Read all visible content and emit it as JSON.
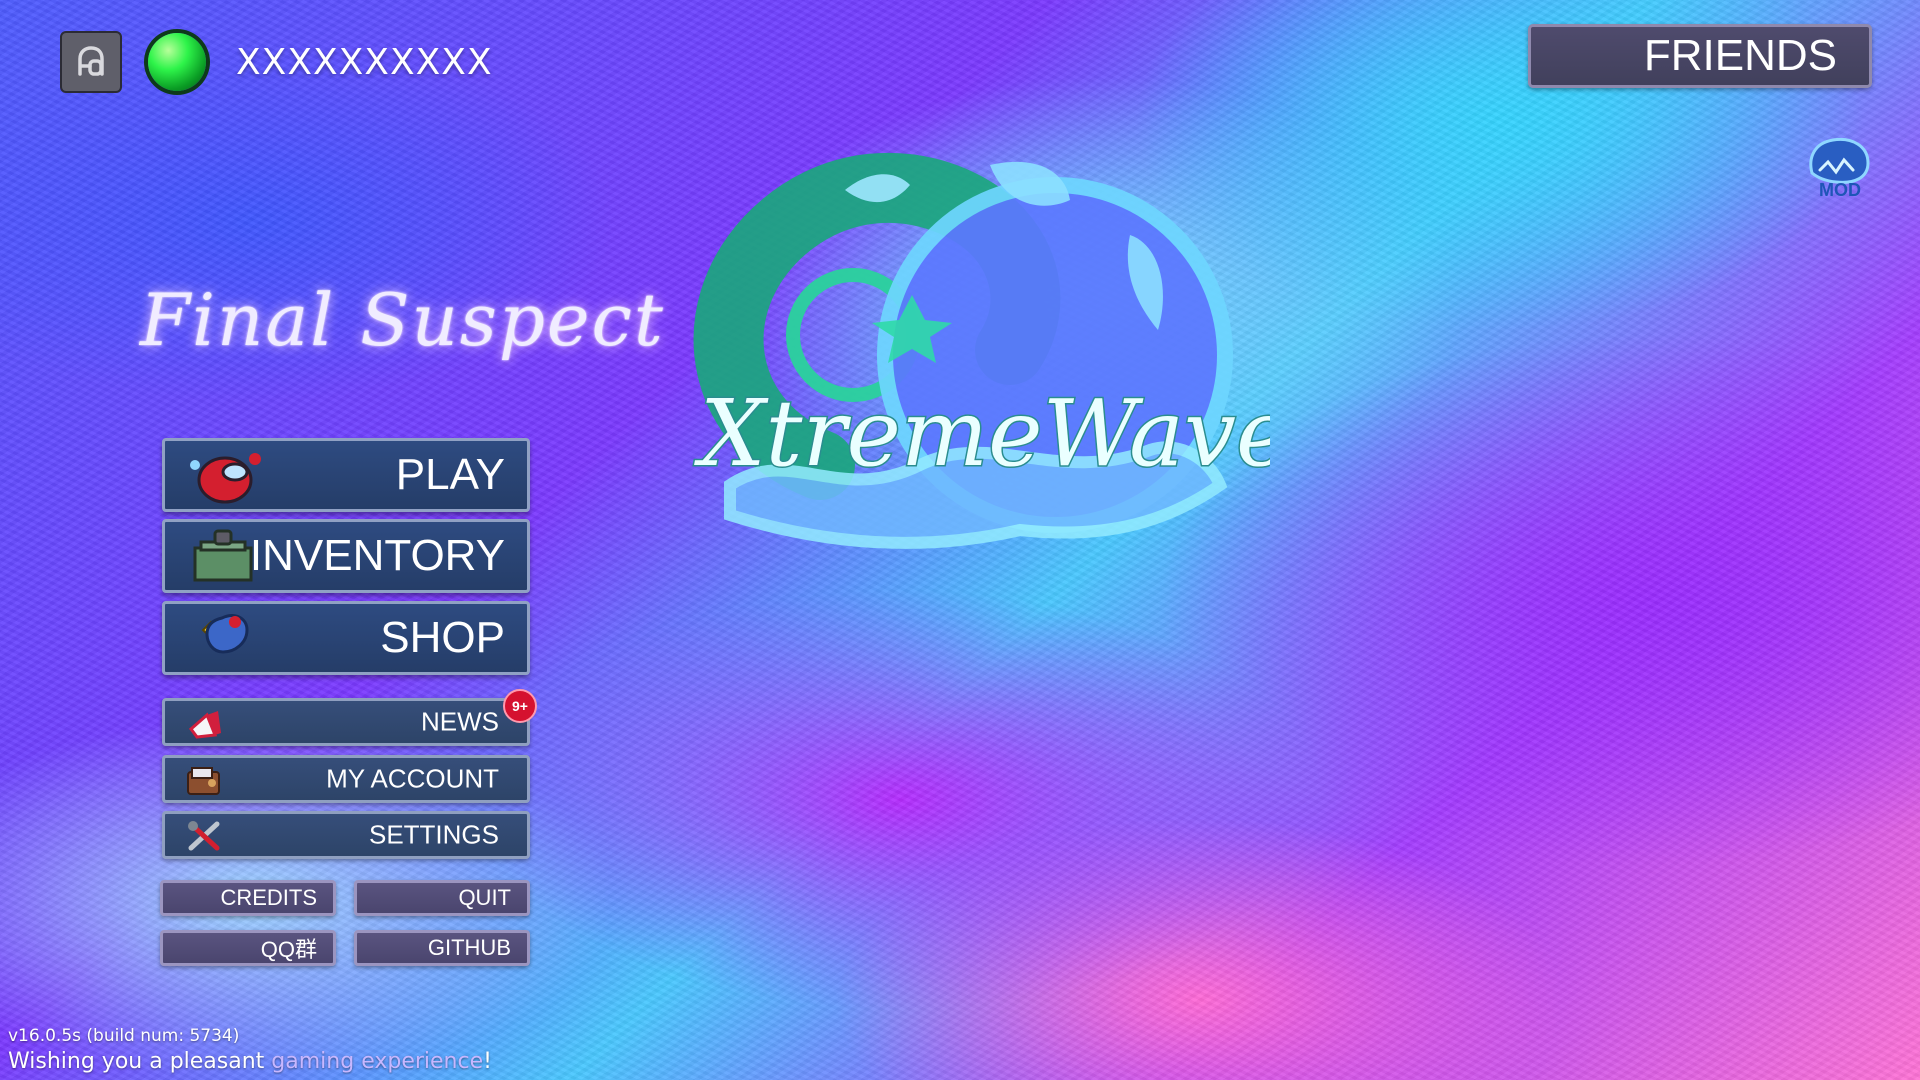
{
  "user": {
    "username": "XXXXXXXXXX"
  },
  "header": {
    "friends_label": "FRIENDS"
  },
  "logos": {
    "game_title": "Final Suspect",
    "brand_text": "XtremeWave",
    "mod_badge": "MOD"
  },
  "menu": {
    "play_label": "PLAY",
    "inventory_label": "INVENTORY",
    "shop_label": "SHOP",
    "news_label": "NEWS",
    "news_badge": "9+",
    "my_account_label": "MY ACCOUNT",
    "settings_label": "SETTINGS"
  },
  "footer_buttons": {
    "credits_label": "CREDITS",
    "quit_label": "QUIT",
    "qq_label": "QQ群",
    "github_label": "GITHUB"
  },
  "footer": {
    "version": "v16.0.5s (build num: 5734)",
    "greeting_start": "Wishing you a pleasant ",
    "greeting_highlight": "gaming experience",
    "greeting_end": "!"
  },
  "colors": {
    "button_primary": "#2b4676",
    "button_border": "#90a1c4",
    "button_secondary": "#504a75",
    "status_online": "#19d43d",
    "badge_red": "#d5112f"
  },
  "icons": [
    "profile-icon",
    "online-status-icon",
    "mod-badge-icon",
    "play-icon",
    "inventory-icon",
    "shop-icon",
    "news-icon",
    "account-icon",
    "settings-icon"
  ]
}
